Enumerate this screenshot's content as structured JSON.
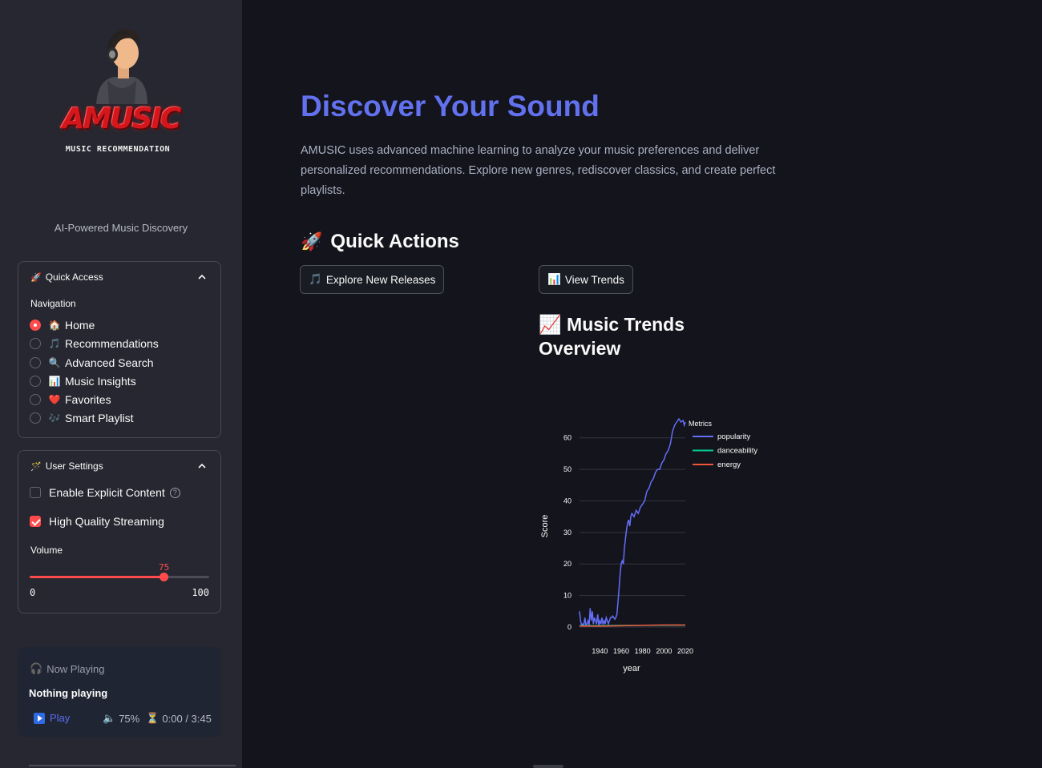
{
  "sidebar": {
    "logo_text": "AMUSIC",
    "logo_subtitle": "MUSIC RECOMMENDATION",
    "tagline": "AI-Powered Music Discovery",
    "quick_access": {
      "title": "Quick Access",
      "icon": "rocket-icon",
      "nav_label": "Navigation",
      "items": [
        {
          "label": "Home",
          "icon": "🏠",
          "selected": true
        },
        {
          "label": "Recommendations",
          "icon": "🎵",
          "selected": false
        },
        {
          "label": "Advanced Search",
          "icon": "🔍",
          "selected": false
        },
        {
          "label": "Music Insights",
          "icon": "📊",
          "selected": false
        },
        {
          "label": "Favorites",
          "icon": "❤️",
          "selected": false
        },
        {
          "label": "Smart Playlist",
          "icon": "🎶",
          "selected": false
        }
      ]
    },
    "user_settings": {
      "title": "User Settings",
      "icon": "wand-icon",
      "explicit_label": "Enable Explicit Content",
      "explicit_checked": false,
      "hq_label": "High Quality Streaming",
      "hq_checked": true,
      "volume_label": "Volume",
      "volume_value": "75",
      "volume_min": "0",
      "volume_max": "100"
    },
    "now_playing": {
      "title": "Now Playing",
      "track": "Nothing playing",
      "play_label": "Play",
      "volume": "75%",
      "time": "0:00 / 3:45"
    }
  },
  "main": {
    "title": "Discover Your Sound",
    "description": "AMUSIC uses advanced machine learning to analyze your music preferences and deliver personalized recommendations. Explore new genres, rediscover classics, and create perfect playlists.",
    "quick_actions_title": "Quick Actions",
    "quick_actions_icon": "🚀",
    "btn_explore": "Explore New Releases",
    "btn_explore_icon": "🎵",
    "btn_trends": "View Trends",
    "btn_trends_icon": "📊",
    "trends_title_line1": "Music Trends",
    "trends_title_line2": "Overview",
    "trends_icon": "📈"
  },
  "colors": {
    "accent": "#ff4b4b",
    "title_blue": "#6271ee",
    "popularity": "#636efa",
    "danceability": "#00cc96",
    "energy": "#ef553b"
  },
  "chart_data": {
    "type": "line",
    "xlabel": "year",
    "ylabel": "Score",
    "legend_title": "Metrics",
    "xlim": [
      1921,
      2020
    ],
    "ylim": [
      0,
      65
    ],
    "x_ticks": [
      1940,
      1960,
      1980,
      2000,
      2020
    ],
    "y_ticks": [
      0,
      10,
      20,
      30,
      40,
      50,
      60
    ],
    "series": [
      {
        "name": "popularity",
        "x": [
          1921,
          1922,
          1923,
          1924,
          1925,
          1926,
          1927,
          1928,
          1929,
          1930,
          1931,
          1932,
          1933,
          1934,
          1935,
          1936,
          1937,
          1938,
          1939,
          1940,
          1941,
          1942,
          1943,
          1944,
          1945,
          1946,
          1947,
          1948,
          1949,
          1950,
          1951,
          1952,
          1953,
          1954,
          1955,
          1956,
          1957,
          1958,
          1959,
          1960,
          1961,
          1962,
          1963,
          1964,
          1965,
          1966,
          1967,
          1968,
          1969,
          1970,
          1972,
          1974,
          1976,
          1978,
          1980,
          1982,
          1984,
          1986,
          1988,
          1990,
          1992,
          1994,
          1996,
          1998,
          2000,
          2002,
          2004,
          2006,
          2008,
          2010,
          2012,
          2014,
          2016,
          2018,
          2019,
          2020
        ],
        "values": [
          5,
          2,
          0.5,
          1,
          0.5,
          3,
          0.5,
          1,
          2,
          0.5,
          6,
          2,
          5,
          1,
          3,
          2,
          1,
          4,
          0.5,
          2,
          1,
          3,
          0.8,
          2,
          1,
          3,
          2,
          1,
          2,
          3,
          3,
          3.5,
          3,
          2.5,
          3,
          4,
          8,
          12,
          17,
          20,
          21,
          20,
          25,
          28,
          31,
          33,
          34,
          32,
          35,
          36,
          35,
          37,
          36,
          38,
          39,
          40,
          43,
          44,
          46,
          47,
          49,
          50,
          50,
          52,
          53,
          55,
          56,
          58,
          62,
          64,
          65,
          66,
          65,
          65.5,
          64,
          65
        ]
      },
      {
        "name": "danceability",
        "x": [
          1921,
          1940,
          1960,
          1980,
          2000,
          2020
        ],
        "values": [
          0.42,
          0.45,
          0.5,
          0.53,
          0.58,
          0.62
        ]
      },
      {
        "name": "energy",
        "x": [
          1921,
          1940,
          1960,
          1980,
          2000,
          2020
        ],
        "values": [
          0.3,
          0.28,
          0.4,
          0.55,
          0.65,
          0.67
        ]
      }
    ]
  }
}
